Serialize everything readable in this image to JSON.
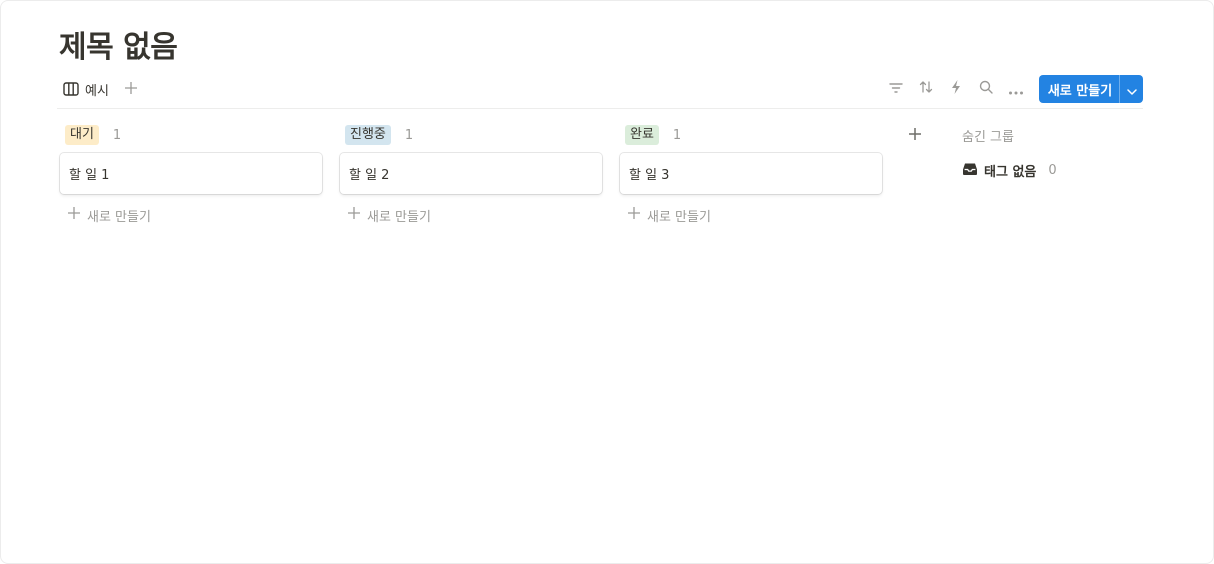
{
  "page": {
    "title": "제목 없음"
  },
  "toolbar": {
    "view_tab_label": "예시",
    "new_button_label": "새로 만들기",
    "icons": [
      "board-icon",
      "plus-icon",
      "filter-icon",
      "sort-icon",
      "lightning-icon",
      "search-icon",
      "more-icon",
      "chevron-down-icon"
    ]
  },
  "board": {
    "columns": [
      {
        "tag": "대기",
        "count": "1",
        "tag_color": "#fdecc8",
        "cards": [
          {
            "title": "할 일 1"
          }
        ],
        "new_label": "새로 만들기"
      },
      {
        "tag": "진행중",
        "count": "1",
        "tag_color": "#d3e5ef",
        "cards": [
          {
            "title": "할 일 2"
          }
        ],
        "new_label": "새로 만들기"
      },
      {
        "tag": "완료",
        "count": "1",
        "tag_color": "#dbeddb",
        "cards": [
          {
            "title": "할 일 3"
          }
        ],
        "new_label": "새로 만들기"
      }
    ],
    "hidden_groups": {
      "title": "숨긴 그룹",
      "items": [
        {
          "label": "태그 없음",
          "count": "0"
        }
      ]
    }
  },
  "colors": {
    "accent": "#2383e2",
    "muted": "#9b9a97",
    "text": "#37352f"
  }
}
